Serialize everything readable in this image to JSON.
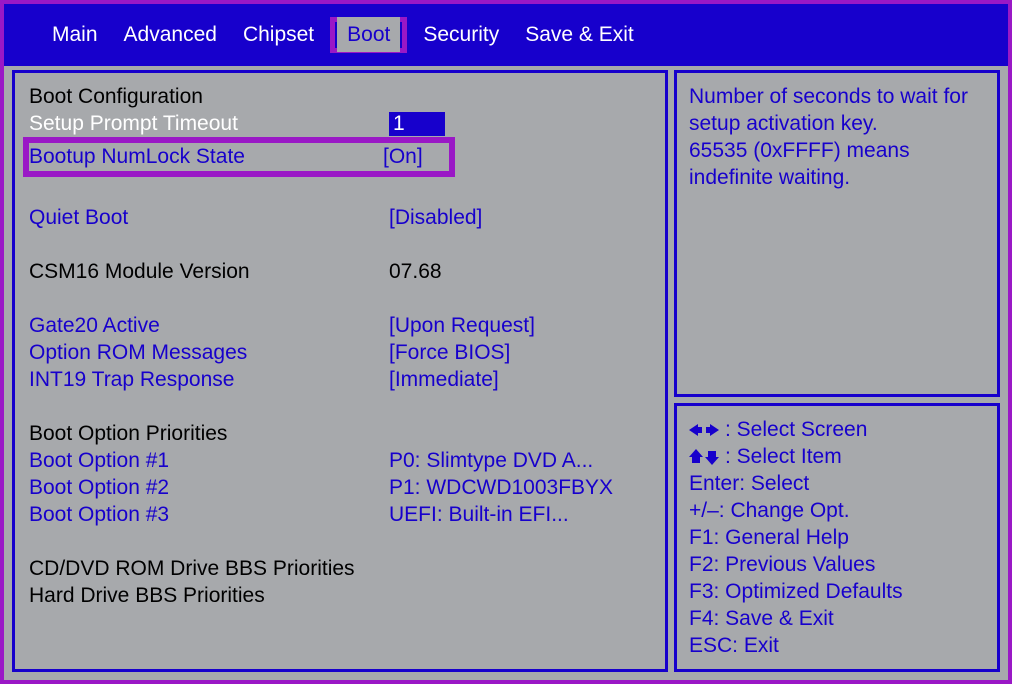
{
  "tabs": {
    "main": "Main",
    "advanced": "Advanced",
    "chipset": "Chipset",
    "boot": "Boot",
    "security": "Security",
    "saveexit": "Save & Exit"
  },
  "left": {
    "section_boot_cfg": "Boot Configuration",
    "setup_prompt_label": "Setup Prompt Timeout",
    "setup_prompt_value": "1",
    "numlock_label": "Bootup NumLock State",
    "numlock_value": "[On]",
    "quiet_boot_label": "Quiet Boot",
    "quiet_boot_value": "[Disabled]",
    "csm_label": "CSM16 Module Version",
    "csm_value": "07.68",
    "gate20_label": "Gate20 Active",
    "gate20_value": "[Upon Request]",
    "oprom_label": "Option ROM Messages",
    "oprom_value": "[Force BIOS]",
    "int19_label": "INT19 Trap Response",
    "int19_value": "[Immediate]",
    "section_priorities": "Boot Option Priorities",
    "opt1_label": "Boot Option #1",
    "opt1_value": "P0: Slimtype DVD A...",
    "opt2_label": "Boot Option #2",
    "opt2_value": "P1: WDCWD1003FBYX",
    "opt3_label": "Boot Option #3",
    "opt3_value": "UEFI: Built-in EFI...",
    "cd_bbs": "CD/DVD ROM Drive BBS Priorities",
    "hd_bbs": "Hard Drive BBS Priorities"
  },
  "help": {
    "l1": "Number of seconds to wait for",
    "l2": "setup activation key.",
    "l3": "65535 (0xFFFF) means",
    "l4": "indefinite waiting."
  },
  "legend": {
    "select_screen": ": Select Screen",
    "select_item": ": Select Item",
    "enter": "Enter: Select",
    "change": "+/–: Change Opt.",
    "f1": "F1: General Help",
    "f2": "F2: Previous Values",
    "f3": "F3: Optimized Defaults",
    "f4": "F4: Save & Exit",
    "esc": "ESC: Exit"
  }
}
